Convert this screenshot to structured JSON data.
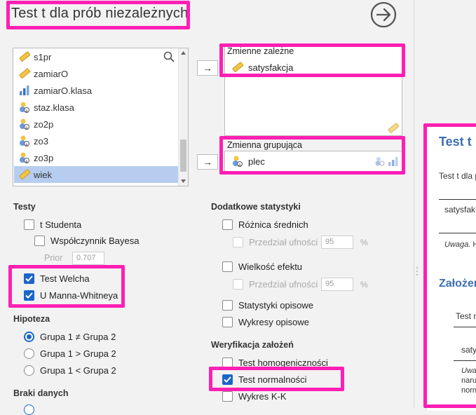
{
  "title": "Test t dla prób niezależnych",
  "variables": [
    {
      "name": "s1pr",
      "icon": "ruler-icon"
    },
    {
      "name": "zamiarO",
      "icon": "ruler-icon"
    },
    {
      "name": "zamiarO.klasa",
      "icon": "bar-chart-icon"
    },
    {
      "name": "staz.klasa",
      "icon": "nominal-icon"
    },
    {
      "name": "zo2p",
      "icon": "nominal-icon"
    },
    {
      "name": "zo3",
      "icon": "nominal-icon"
    },
    {
      "name": "zo3p",
      "icon": "nominal-icon"
    },
    {
      "name": "wiek",
      "icon": "ruler-icon",
      "selected": true
    }
  ],
  "dependent": {
    "label": "Zmienne zależne",
    "items": [
      "satysfakcja"
    ]
  },
  "grouping": {
    "label": "Zmienna grupująca",
    "value": "plec"
  },
  "tests": {
    "header": "Testy",
    "student": {
      "label": "t Studenta",
      "checked": false
    },
    "bayes": {
      "label": "Współczynnik Bayesa",
      "checked": false
    },
    "prior_label": "Prior",
    "prior_value": "0.707",
    "welch": {
      "label": "Test Welcha",
      "checked": true
    },
    "mann": {
      "label": "U Manna-Whitneya",
      "checked": true
    }
  },
  "hypothesis": {
    "header": "Hipoteza",
    "options": [
      "Grupa 1 ≠ Grupa 2",
      "Grupa 1 > Grupa 2",
      "Grupa 1 < Grupa 2"
    ],
    "selected": 0
  },
  "missing": {
    "header": "Braki danych"
  },
  "extra": {
    "header": "Dodatkowe statystyki",
    "meandiff": "Różnica średnich",
    "ci_label": "Przedział ufności",
    "ci_value": "95",
    "pct": "%",
    "effect": "Wielkość efektu",
    "ci2_value": "95",
    "descriptives": "Statystyki opisowe",
    "plots": "Wykresy opisowe"
  },
  "assumptions": {
    "header": "Weryfikacja założeń",
    "homog": "Test homogeniczności",
    "normal": "Test normalności",
    "qq": "Wykres K-K"
  },
  "results": {
    "title": "Test t",
    "table_title": "Test t dla p",
    "row": "satysfak",
    "note_label": "Uwaga.",
    "note_text": "H",
    "section": "Założen",
    "test_label": "Test n",
    "row2": "saty",
    "note2a": "Uwa",
    "note2b": "naru",
    "note2c": "norn"
  },
  "colors": {
    "highlight": "#ff1fb4",
    "accent": "#1a66c9",
    "selected_row": "#b7cdef",
    "results_title": "#3e6fb0"
  }
}
